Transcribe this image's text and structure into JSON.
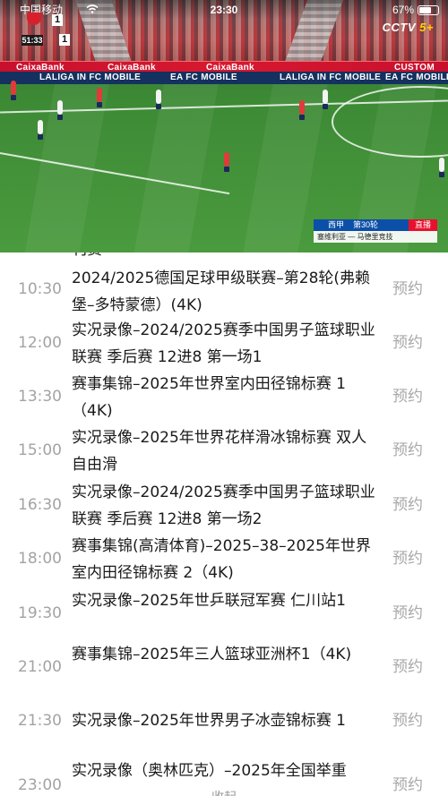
{
  "status_bar": {
    "carrier": "中国移动",
    "time": "23:30",
    "battery_percent": "67%",
    "battery_level": 0.67
  },
  "video": {
    "channel_logo": "CCTV",
    "channel_suffix": "5+",
    "scoreboard": {
      "home_score": "1",
      "away_score": "1",
      "match_clock": "51:33"
    },
    "ads": {
      "board1": "CaixaBank",
      "board2": "LALIGA IN FC MOBILE",
      "board3": "EA FC MOBILE",
      "board4": "CUSTOM"
    },
    "broadcast_bar": {
      "league": "西甲",
      "round": "第30轮",
      "live_label": "直播",
      "matchup": "塞维利亚 — 马德里竞技"
    }
  },
  "schedule": {
    "partial_top": "刊赛",
    "items": [
      {
        "time": "10:30",
        "title": "2024/2025德国足球甲级联赛–第28轮(弗赖堡–多特蒙德）(4K)",
        "action": "预约"
      },
      {
        "time": "12:00",
        "title": "实况录像–2024/2025赛季中国男子篮球职业联赛 季后赛 12进8 第一场1",
        "action": "预约"
      },
      {
        "time": "13:30",
        "title": "赛事集锦–2025年世界室内田径锦标赛 1（4K)",
        "action": "预约"
      },
      {
        "time": "15:00",
        "title": "实况录像–2025年世界花样滑冰锦标赛 双人自由滑",
        "action": "预约"
      },
      {
        "time": "16:30",
        "title": "实况录像–2024/2025赛季中国男子篮球职业联赛 季后赛 12进8 第一场2",
        "action": "预约"
      },
      {
        "time": "18:00",
        "title": "赛事集锦(高清体育)–2025–38–2025年世界室内田径锦标赛 2（4K)",
        "action": "预约"
      },
      {
        "time": "19:30",
        "title": "实况录像–2025年世乒联冠军赛 仁川站1",
        "action": "预约"
      },
      {
        "time": "21:00",
        "title": "赛事集锦–2025年三人篮球亚洲杯1（4K)",
        "action": "预约"
      },
      {
        "time": "21:30",
        "title": "实况录像–2025年世界男子冰壶锦标赛 1",
        "action": "预约"
      },
      {
        "time": "23:00",
        "title": "实况录像（奥林匹克）–2025年全国举重",
        "action": "预约"
      }
    ],
    "bottom_hint": "收起"
  }
}
